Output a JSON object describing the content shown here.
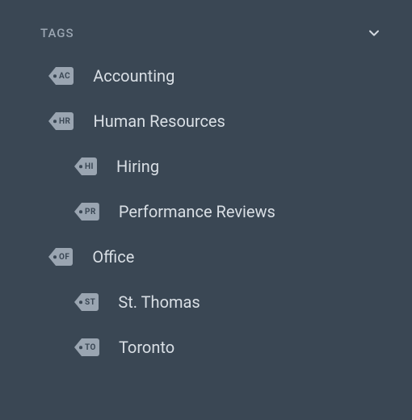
{
  "section": {
    "title": "TAGS"
  },
  "tags": [
    {
      "code": "AC",
      "label": "Accounting",
      "level": 0
    },
    {
      "code": "HR",
      "label": "Human Resources",
      "level": 0
    },
    {
      "code": "HI",
      "label": "Hiring",
      "level": 1
    },
    {
      "code": "PR",
      "label": "Performance Reviews",
      "level": 1
    },
    {
      "code": "OF",
      "label": "Office",
      "level": 0
    },
    {
      "code": "ST",
      "label": "St. Thomas",
      "level": 1
    },
    {
      "code": "TO",
      "label": "Toronto",
      "level": 1
    }
  ]
}
